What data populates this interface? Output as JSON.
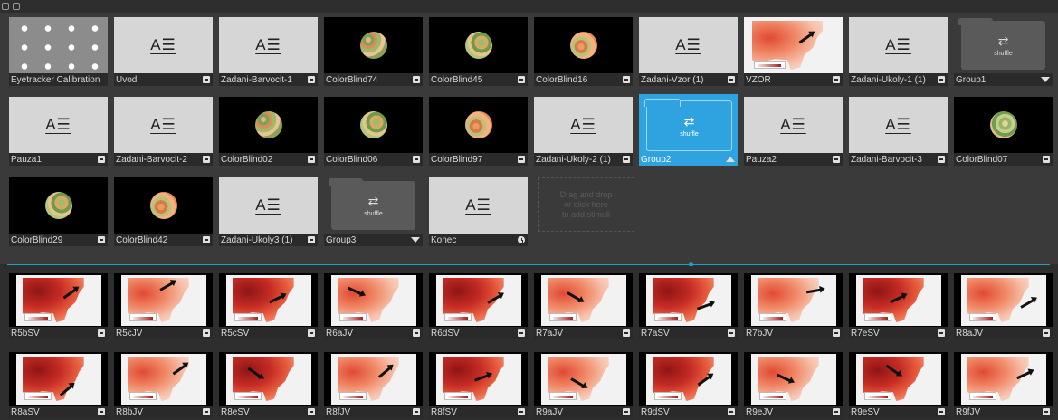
{
  "stimuli": [
    {
      "name": "Eyetracker Calibration",
      "kind": "calibration",
      "icon": "none"
    },
    {
      "name": "Uvod",
      "kind": "text",
      "icon": "export-icon"
    },
    {
      "name": "Zadani-Barvocit-1",
      "kind": "text",
      "icon": "export-icon"
    },
    {
      "name": "ColorBlind74",
      "kind": "plate",
      "icon": "export-icon"
    },
    {
      "name": "ColorBlind45",
      "kind": "plate",
      "icon": "export-icon"
    },
    {
      "name": "ColorBlind16",
      "kind": "plate",
      "icon": "export-icon"
    },
    {
      "name": "Zadani-Vzor (1)",
      "kind": "text",
      "icon": "export-icon"
    },
    {
      "name": "VZOR",
      "kind": "map",
      "icon": "export-icon"
    },
    {
      "name": "Zadani-Ukoly-1 (1)",
      "kind": "text",
      "icon": "export-icon"
    },
    {
      "name": "Group1",
      "kind": "group",
      "icon": "caret-down-icon"
    },
    {
      "name": "Pauza1",
      "kind": "text",
      "icon": "export-icon"
    },
    {
      "name": "Zadani-Barvocit-2",
      "kind": "text",
      "icon": "export-icon"
    },
    {
      "name": "ColorBlind02",
      "kind": "plate",
      "icon": "export-icon"
    },
    {
      "name": "ColorBlind06",
      "kind": "plate",
      "icon": "export-icon"
    },
    {
      "name": "ColorBlind97",
      "kind": "plate",
      "icon": "export-icon"
    },
    {
      "name": "Zadani-Ukoly-2 (1)",
      "kind": "text",
      "icon": "export-icon"
    },
    {
      "name": "Group2",
      "kind": "group",
      "icon": "caret-up-icon",
      "selected": true
    },
    {
      "name": "Pauza2",
      "kind": "text",
      "icon": "export-icon"
    },
    {
      "name": "Zadani-Barvocit-3",
      "kind": "text",
      "icon": "export-icon"
    },
    {
      "name": "ColorBlind07",
      "kind": "plate",
      "icon": "export-icon"
    },
    {
      "name": "ColorBlind29",
      "kind": "plate",
      "icon": "export-icon"
    },
    {
      "name": "ColorBlind42",
      "kind": "plate",
      "icon": "export-icon"
    },
    {
      "name": "Zadani-Ukoly3 (1)",
      "kind": "text",
      "icon": "export-icon"
    },
    {
      "name": "Group3",
      "kind": "group",
      "icon": "caret-down-icon"
    },
    {
      "name": "Konec",
      "kind": "text",
      "icon": "clock-icon"
    }
  ],
  "group_label": "shuffle",
  "dropzone_text": [
    "Drag and drop",
    "or click here",
    "to add stimuli"
  ],
  "group_items": [
    "R5bSV",
    "R5cJV",
    "R5cSV",
    "R6aJV",
    "R6dSV",
    "R7aJV",
    "R7aSV",
    "R7bJV",
    "R7eSV",
    "R8aJV",
    "R8aSV",
    "R8bJV",
    "R8eSV",
    "R8fJV",
    "R8fSV",
    "R9aJV",
    "R9dSV",
    "R9eJV",
    "R9eSV",
    "R9fJV"
  ],
  "colors": {
    "accent": "#2fa3e0",
    "connector": "#19a0c4",
    "background": "#3a3a3a"
  }
}
